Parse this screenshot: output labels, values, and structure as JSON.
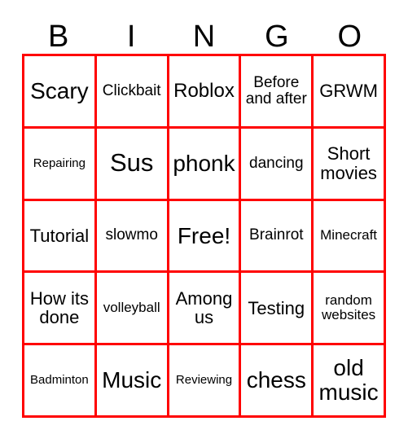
{
  "card": {
    "title": "BINGO",
    "border_color": "#ff0000",
    "text_color": "#000000",
    "background_color": "#ffffff"
  },
  "header": {
    "letters": [
      {
        "label": "B"
      },
      {
        "label": "I"
      },
      {
        "label": "N"
      },
      {
        "label": "G"
      },
      {
        "label": "O"
      }
    ]
  },
  "grid": {
    "columns": 5,
    "rows": 5,
    "cells": [
      {
        "label": "Scary",
        "size": "fs-2xl"
      },
      {
        "label": "Clickbait",
        "size": "fs-md"
      },
      {
        "label": "Roblox",
        "size": "fs-xl"
      },
      {
        "label": "Before and after",
        "size": "fs-md"
      },
      {
        "label": "GRWM",
        "size": "fs-lg"
      },
      {
        "label": "Repairing",
        "size": "fs-xs"
      },
      {
        "label": "Sus",
        "size": "fs-3xl"
      },
      {
        "label": "phonk",
        "size": "fs-2xl"
      },
      {
        "label": "dancing",
        "size": "fs-md"
      },
      {
        "label": "Short movies",
        "size": "fs-lg"
      },
      {
        "label": "Tutorial",
        "size": "fs-lg"
      },
      {
        "label": "slowmo",
        "size": "fs-md"
      },
      {
        "label": "Free!",
        "size": "fs-2xl"
      },
      {
        "label": "Brainrot",
        "size": "fs-md"
      },
      {
        "label": "Minecraft",
        "size": "fs-sm"
      },
      {
        "label": "How its done",
        "size": "fs-lg"
      },
      {
        "label": "volleyball",
        "size": "fs-sm"
      },
      {
        "label": "Among us",
        "size": "fs-lg"
      },
      {
        "label": "Testing",
        "size": "fs-lg"
      },
      {
        "label": "random websites",
        "size": "fs-sm"
      },
      {
        "label": "Badminton",
        "size": "fs-xs"
      },
      {
        "label": "Music",
        "size": "fs-2xl"
      },
      {
        "label": "Reviewing",
        "size": "fs-xs"
      },
      {
        "label": "chess",
        "size": "fs-2xl"
      },
      {
        "label": "old music",
        "size": "fs-2xl"
      }
    ]
  }
}
